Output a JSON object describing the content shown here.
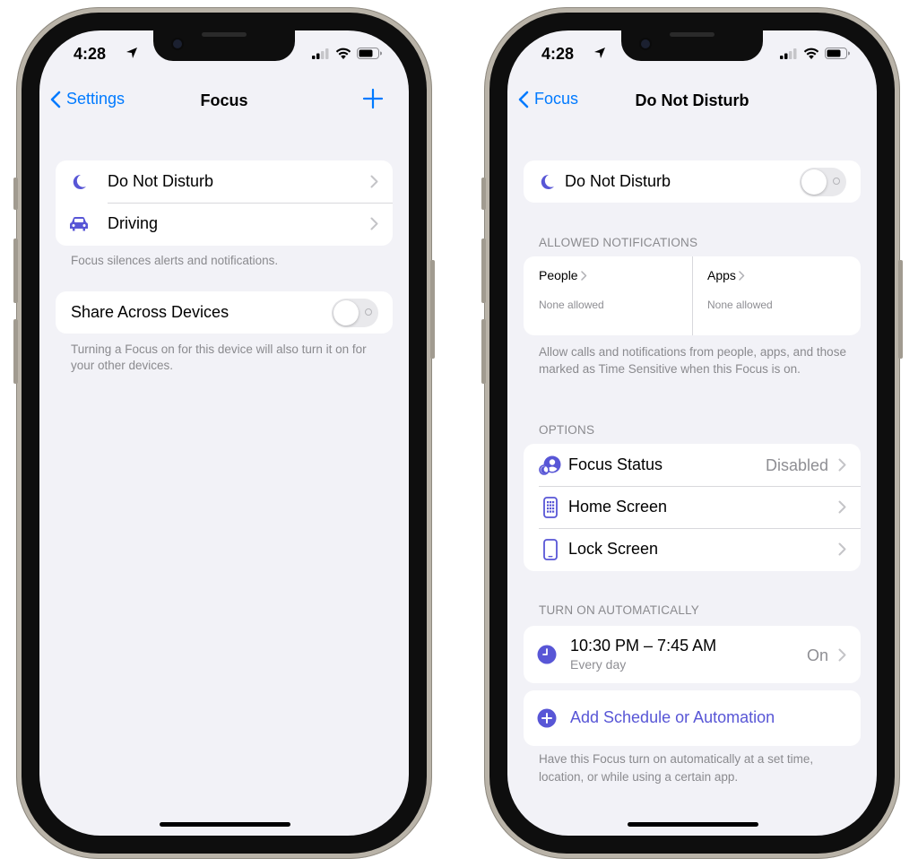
{
  "colors": {
    "accent": "#007aff",
    "focus_purple": "#5856d6",
    "background": "#f2f2f7",
    "secondary_text": "#8e8e93"
  },
  "left": {
    "status": {
      "time": "4:28"
    },
    "nav": {
      "back_label": "Settings",
      "title": "Focus",
      "add_icon": "plus-icon"
    },
    "focus_list": [
      {
        "label": "Do Not Disturb",
        "icon": "moon-icon"
      },
      {
        "label": "Driving",
        "icon": "car-icon"
      }
    ],
    "focus_footer": "Focus silences alerts and notifications.",
    "share": {
      "label": "Share Across Devices",
      "enabled": false
    },
    "share_footer": "Turning a Focus on for this device will also turn it on for your other devices."
  },
  "right": {
    "status": {
      "time": "4:28"
    },
    "nav": {
      "back_label": "Focus",
      "title": "Do Not Disturb"
    },
    "dnd": {
      "label": "Do Not Disturb",
      "enabled": false
    },
    "allowed": {
      "header": "ALLOWED NOTIFICATIONS",
      "people": {
        "title": "People",
        "subtitle": "None allowed"
      },
      "apps": {
        "title": "Apps",
        "subtitle": "None allowed"
      },
      "footer": "Allow calls and notifications from people, apps, and those marked as Time Sensitive when this Focus is on."
    },
    "options": {
      "header": "OPTIONS",
      "items": [
        {
          "label": "Focus Status",
          "value": "Disabled",
          "icon": "focus-status-icon"
        },
        {
          "label": "Home Screen",
          "value": "",
          "icon": "home-screen-icon"
        },
        {
          "label": "Lock Screen",
          "value": "",
          "icon": "lock-screen-icon"
        }
      ]
    },
    "automation": {
      "header": "TURN ON AUTOMATICALLY",
      "schedule": {
        "time": "10:30 PM – 7:45 AM",
        "repeat": "Every day",
        "state": "On"
      },
      "add_label": "Add Schedule or Automation",
      "footer": "Have this Focus turn on automatically at a set time, location, or while using a certain app."
    }
  }
}
